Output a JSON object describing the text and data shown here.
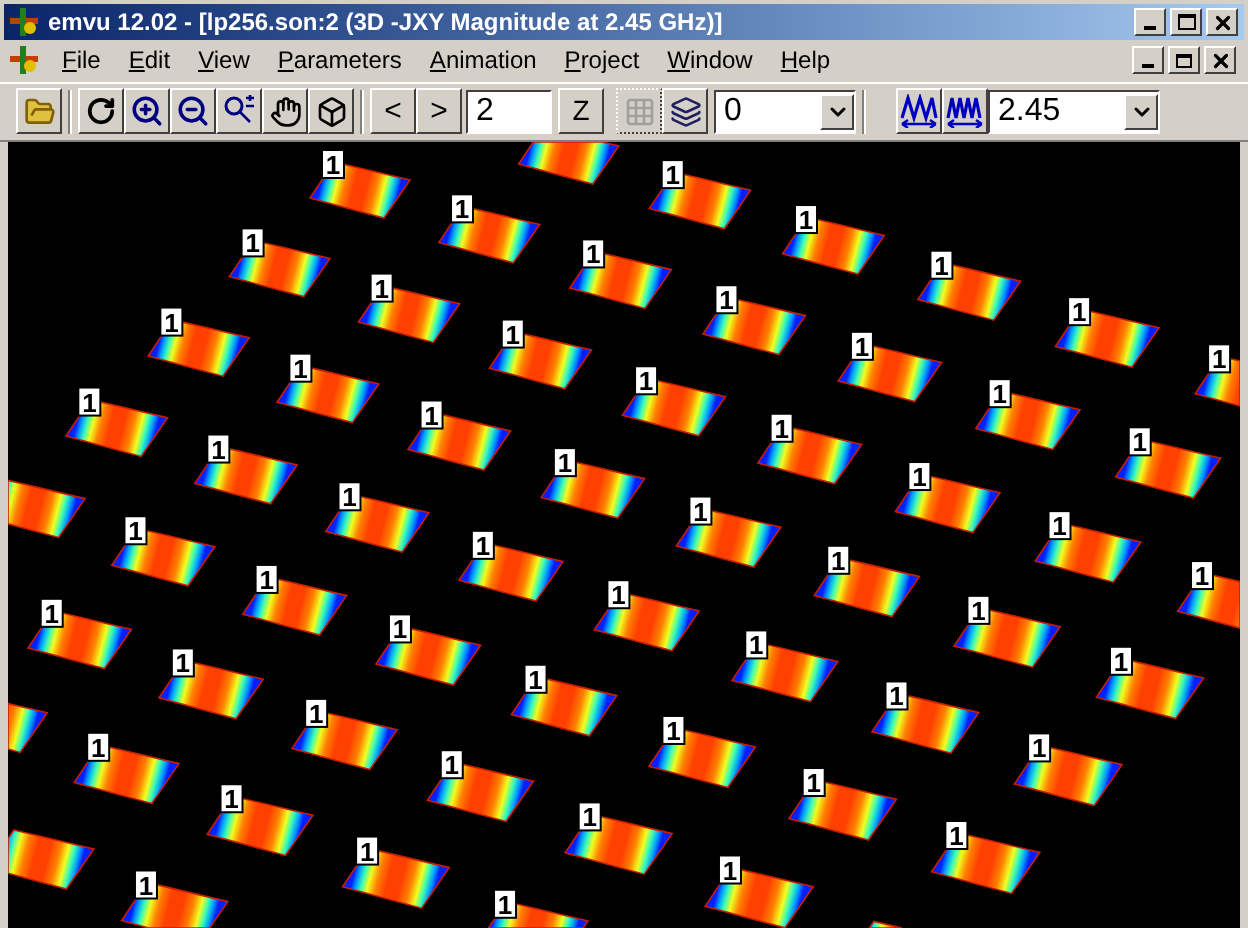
{
  "window": {
    "title": "emvu 12.02 - [lp256.son:2 (3D -JXY Magnitude at 2.45 GHz)]"
  },
  "menu": [
    {
      "label": "File"
    },
    {
      "label": "Edit"
    },
    {
      "label": "View"
    },
    {
      "label": "Parameters"
    },
    {
      "label": "Animation"
    },
    {
      "label": "Project"
    },
    {
      "label": "Window"
    },
    {
      "label": "Help"
    }
  ],
  "toolbar": {
    "prev_button": "<",
    "next_button": ">",
    "frame_field": "2",
    "z_button": "Z",
    "mesh_button": {
      "disabled": true
    },
    "layer_select": "0",
    "frequency_select": "2.45"
  },
  "canvas": {
    "port_labels": [
      "1",
      "1",
      "1",
      "1",
      "1",
      "1",
      "1",
      "1",
      "1",
      "1",
      "1",
      "1",
      "1",
      "1",
      "1",
      "1",
      "1",
      "1",
      "1",
      "1",
      "1",
      "1",
      "1",
      "1",
      "1",
      "1",
      "1",
      "1",
      "1",
      "1",
      "1",
      "1",
      "1",
      "1",
      "1",
      "1",
      "1",
      "1",
      "1",
      "1",
      "1",
      "1",
      "1",
      "1",
      "1",
      "1",
      "1",
      "1",
      "1",
      "1",
      "1",
      "1",
      "1",
      "1"
    ]
  }
}
